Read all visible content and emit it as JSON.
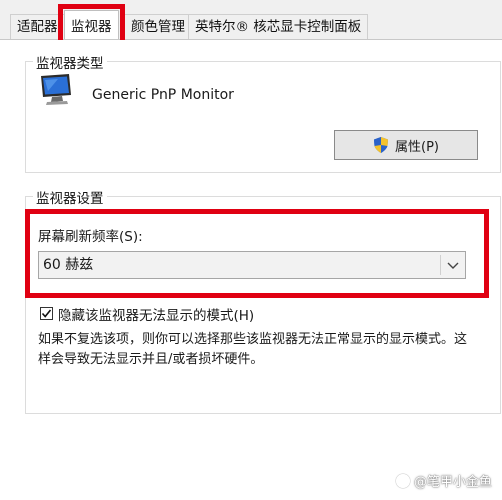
{
  "tabs": [
    {
      "label": "适配器",
      "active": false
    },
    {
      "label": "监视器",
      "active": true
    },
    {
      "label": "颜色管理",
      "active": false
    },
    {
      "label": "英特尔® 核芯显卡控制面板",
      "active": false
    }
  ],
  "monitor_type": {
    "group_title": "监视器类型",
    "monitor_name": "Generic PnP Monitor",
    "properties_button": "属性(P)"
  },
  "monitor_settings": {
    "group_title": "监视器设置",
    "refresh_label": "屏幕刷新频率(S):",
    "refresh_value": "60 赫兹",
    "hide_modes_checked": true,
    "hide_modes_label": "隐藏该监视器无法显示的模式(H)",
    "description": "如果不复选该项，则你可以选择那些该监视器无法正常显示的显示模式。这样会导致无法显示并且/或者损坏硬件。"
  },
  "watermark": "@笔甲小金鱼",
  "colors": {
    "highlight_red": "#e00012"
  }
}
